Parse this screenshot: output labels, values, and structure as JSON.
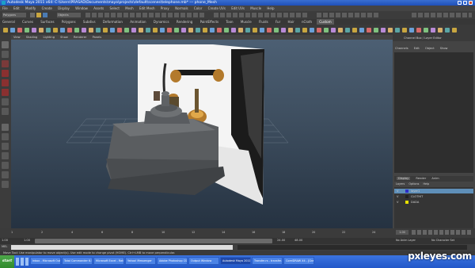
{
  "window": {
    "title": "Autodesk Maya 2011 x64: C:\\Users\\PRASAD\\Documents\\maya\\projects\\default\\scenes\\telephone.mb* --- phone_Mesh"
  },
  "menu": [
    "File",
    "Edit",
    "Modify",
    "Create",
    "Display",
    "Window",
    "Assets",
    "Select",
    "Mesh",
    "Edit Mesh",
    "Proxy",
    "Normals",
    "Color",
    "Create UVs",
    "Edit UVs",
    "Muscle",
    "Help"
  ],
  "status": {
    "mode": "Polygons",
    "search_value": "Objects"
  },
  "shelf": {
    "tabs": [
      "General",
      "Curves",
      "Surfaces",
      "Polygons",
      "Subdivs",
      "Deformation",
      "Animation",
      "Dynamics",
      "Rendering",
      "PaintEffects",
      "Toon",
      "Muscle",
      "Fluids",
      "Fur",
      "Hair",
      "nCloth",
      "Custom"
    ],
    "active_tab": "Custom"
  },
  "panel_menu": [
    "View",
    "Shading",
    "Lighting",
    "Show",
    "Renderer",
    "Panels"
  ],
  "channel_box": {
    "title": "Channel Box / Layer Editor",
    "menu": [
      "Channels",
      "Edit",
      "Object",
      "Show"
    ]
  },
  "layers": {
    "tabs": [
      "Display",
      "Render",
      "Anim"
    ],
    "menu": [
      "Layers",
      "Options",
      "Help"
    ],
    "rows": [
      {
        "visibility": "V",
        "name": "layer1",
        "color": "#2d2dc8"
      },
      {
        "visibility": "V",
        "name": "CLOTHIT",
        "color": "#222222"
      },
      {
        "visibility": "V",
        "name": "DADA",
        "color": "#e8e000"
      }
    ]
  },
  "timeline": {
    "start": "1.00",
    "end": "24.00",
    "range_start": "1.00",
    "range_end": "24.00",
    "range_max": "48.00",
    "anim_layer": "No Anim Layer",
    "char_set": "No Character Set",
    "ticks": [
      "1",
      "2",
      "4",
      "6",
      "8",
      "10",
      "12",
      "14",
      "16",
      "18",
      "20",
      "22",
      "24"
    ]
  },
  "command_line": {
    "label": "MEL"
  },
  "help_line": "Move Tool: Use manipulator to move object(s). Use edit mode to change pivot (HOME). Ctrl+LMB to move perpendicular.",
  "taskbar": {
    "start_label": "start",
    "items": [
      "Inbox - Microsoft Outlook",
      "Total Commander 6.53 ...",
      "Microsoft Excel - Ratios.xls",
      "Yahoo! Messenger",
      "Adobe Photoshop CS4 E...",
      "Output Window",
      "Autodesk Maya 2011 ...",
      "Transfer.rs - transfer.p...",
      "CorelDRAW X4 - [Graphic]"
    ],
    "active_index": 6
  },
  "watermark": "pxleyes.com",
  "colors": {
    "title_blue": "#2a5fc8",
    "ui_gray": "#444444",
    "viewport_top": "#4c5f73",
    "viewport_bottom": "#253241",
    "taskbar_blue": "#2a63d4"
  }
}
